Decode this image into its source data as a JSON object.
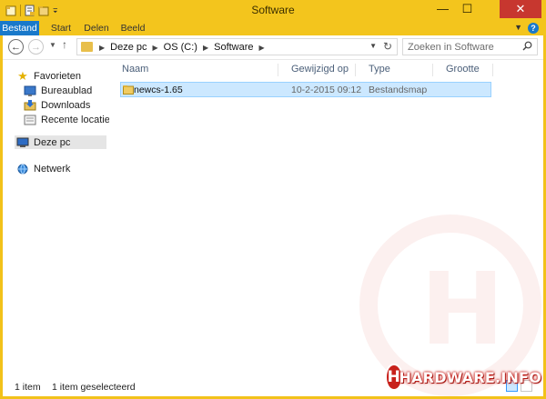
{
  "window": {
    "title": "Software",
    "accent_color": "#f3c51d",
    "controls": {
      "minimize": "—",
      "maximize": "☐",
      "close": "✕"
    }
  },
  "ribbon": {
    "tabs": [
      {
        "label": "Bestand",
        "active": true
      },
      {
        "label": "Start"
      },
      {
        "label": "Delen"
      },
      {
        "label": "Beeld"
      }
    ],
    "help_label": "?"
  },
  "navigation": {
    "breadcrumbs": [
      "Deze pc",
      "OS (C:)",
      "Software"
    ],
    "search_placeholder": "Zoeken in Software"
  },
  "nav_pane": {
    "items": [
      {
        "label": "Favorieten",
        "icon": "star-icon"
      },
      {
        "label": "Bureaublad",
        "icon": "desktop-icon"
      },
      {
        "label": "Downloads",
        "icon": "downloads-icon"
      },
      {
        "label": "Recente locaties",
        "icon": "recent-icon"
      },
      {
        "label": "Deze pc",
        "icon": "computer-icon",
        "selected": true
      },
      {
        "label": "Netwerk",
        "icon": "network-icon"
      }
    ]
  },
  "file_list": {
    "columns": [
      "Naam",
      "Gewijzigd op",
      "Type",
      "Grootte"
    ],
    "rows": [
      {
        "name": "newcs-1.65",
        "modified": "10-2-2015 09:12",
        "type": "Bestandsmap",
        "size": "",
        "selected": true
      }
    ]
  },
  "status": {
    "item_count": "1 item",
    "selection": "1 item geselecteerd"
  },
  "watermark": {
    "brand": "HARDWARE.INFO",
    "brand_color": "#c8211b"
  }
}
